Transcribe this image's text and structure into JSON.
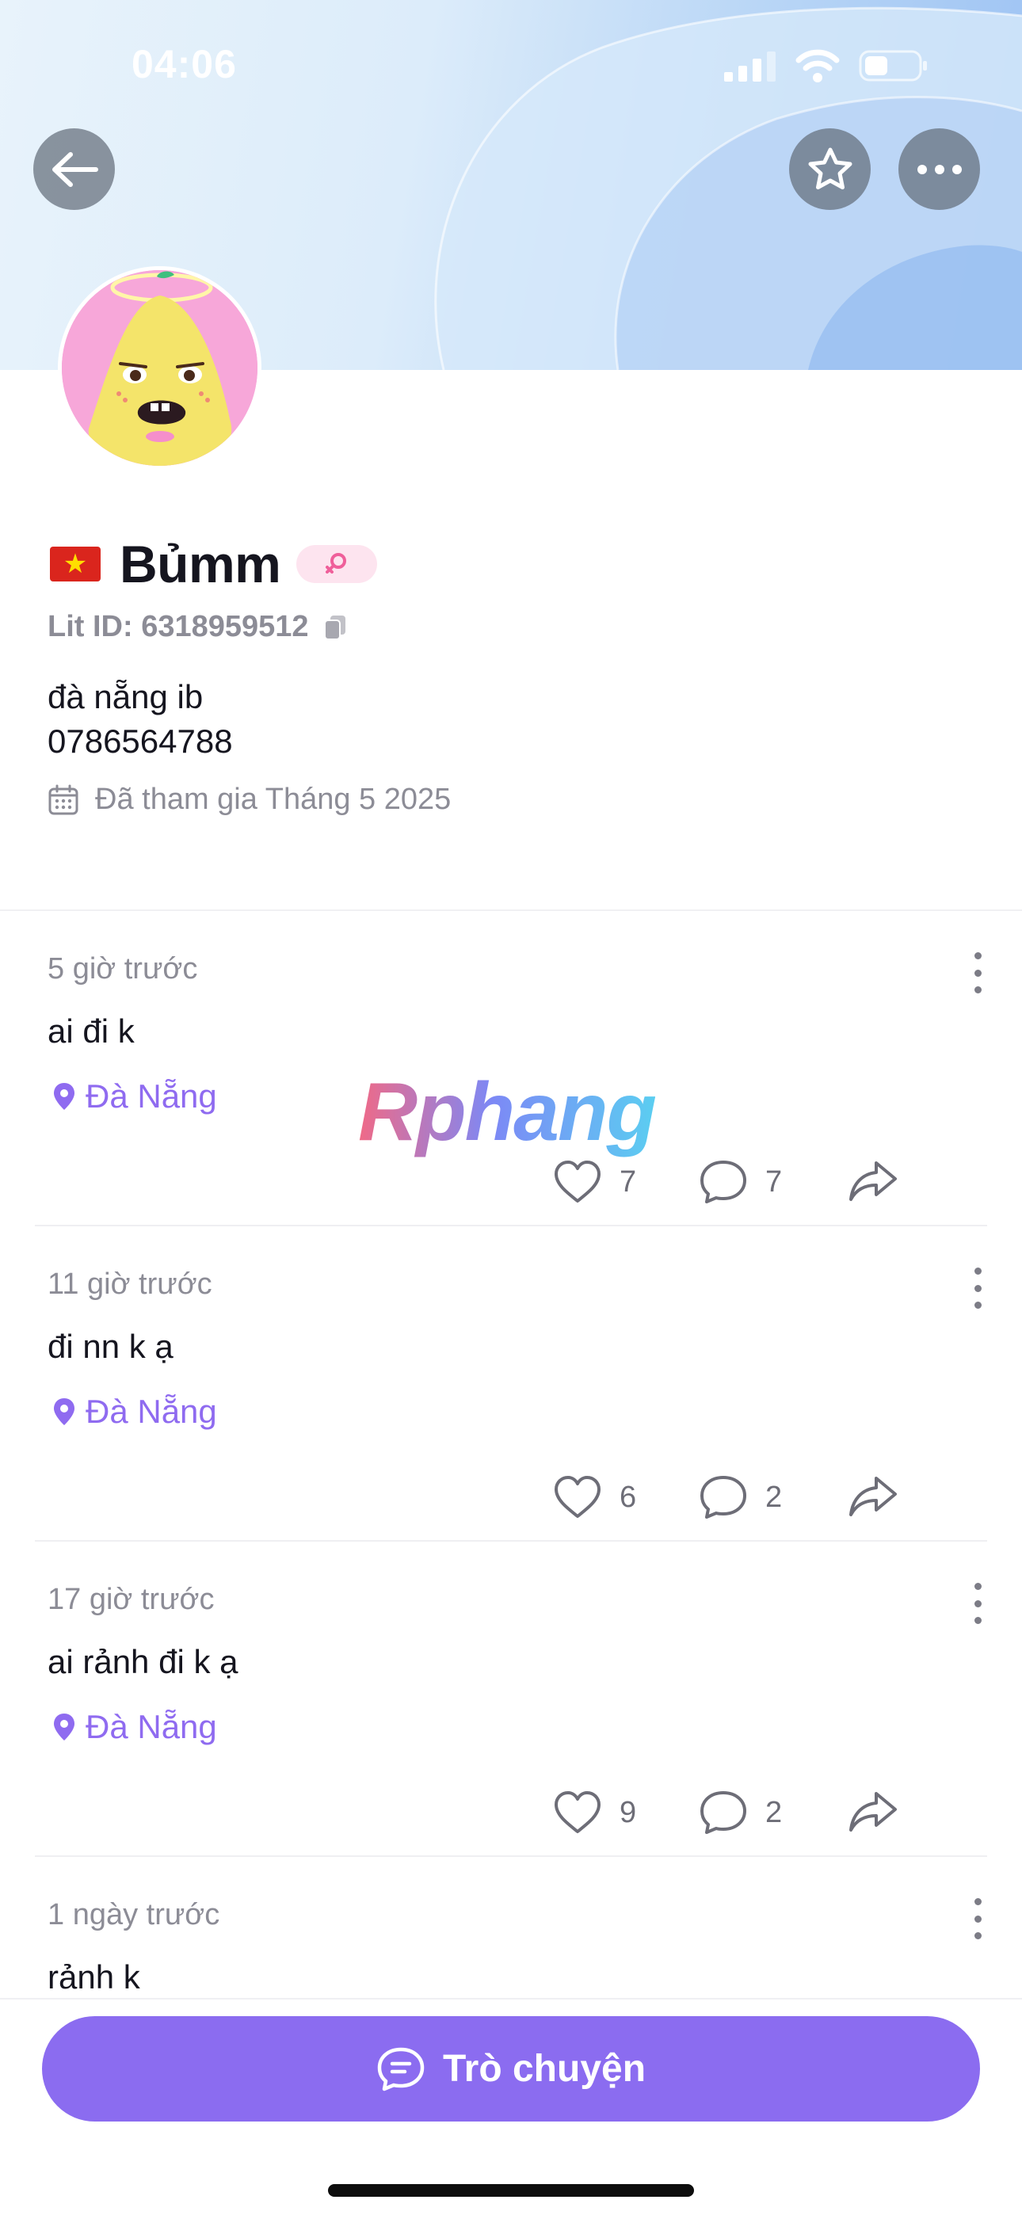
{
  "status_bar": {
    "time": "04:06"
  },
  "profile": {
    "flag": "★",
    "name": "Bủmm",
    "lit_id": "Lit ID: 6318959512",
    "bio": "đà nẵng ib\n0786564788",
    "joined": "Đã tham gia Tháng 5 2025"
  },
  "posts": [
    {
      "time": "5 giờ trước",
      "text": "ai đi k",
      "location": "Đà Nẵng",
      "likes": "7",
      "comments": "7"
    },
    {
      "time": "11 giờ trước",
      "text": "đi nn k ạ",
      "location": "Đà Nẵng",
      "likes": "6",
      "comments": "2"
    },
    {
      "time": "17 giờ trước",
      "text": "ai rảnh đi k ạ",
      "location": "Đà Nẵng",
      "likes": "9",
      "comments": "2"
    },
    {
      "time": "1 ngày trước",
      "text": "rảnh k"
    }
  ],
  "watermark": "Rphang",
  "chat_button": {
    "label": "Trò chuyện"
  },
  "colors": {
    "accent": "#8b6cf0",
    "location": "#8f6bf0",
    "gender_badge": "#fde4ef",
    "gender_icon": "#ef5f9a"
  },
  "icons": {
    "back": "arrow-left-icon",
    "favorite": "star-icon",
    "more": "more-dots-icon",
    "copy": "copy-icon",
    "calendar": "calendar-icon",
    "location": "location-pin-icon",
    "like": "heart-icon",
    "comment": "comment-icon",
    "share": "share-icon",
    "chat": "chat-bubble-icon",
    "gender": "female-icon"
  }
}
